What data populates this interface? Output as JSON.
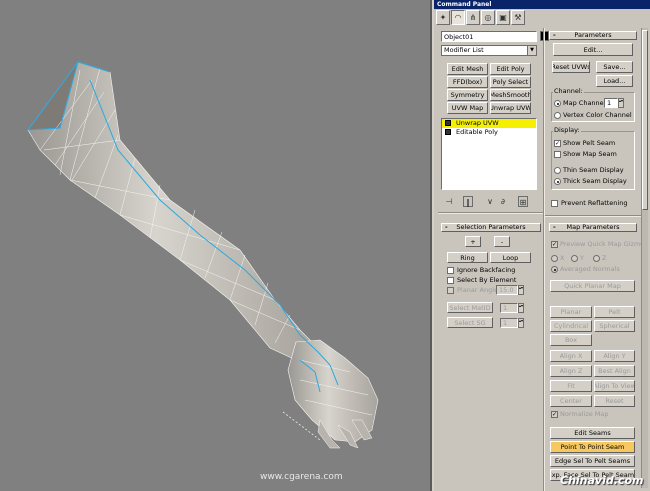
{
  "window": {
    "title": "Command Panel"
  },
  "tabs": [
    "create-tab",
    "modify-tab",
    "hierarchy-tab",
    "motion-tab",
    "display-tab",
    "utilities-tab"
  ],
  "object_name": "Object01",
  "object_color": "#000000",
  "modifier_list": "Modifier List",
  "modifier_buttons": [
    "Edit Mesh",
    "Edit Poly",
    "FFD(box)",
    "Poly Select",
    "Symmetry",
    "MeshSmooth",
    "UVW Map",
    "Unwrap UVW"
  ],
  "stack": [
    "Unwrap UVW",
    "Editable Poly"
  ],
  "parameters": {
    "header": "Parameters",
    "edit": "Edit...",
    "reset_uvws": "Reset UVWs",
    "save": "Save...",
    "load": "Load...",
    "channel_label": "Channel:",
    "map_channel": "Map Channel:",
    "map_channel_value": "1",
    "vertex_color_channel": "Vertex Color Channel",
    "display_label": "Display:",
    "show_pelt_seam": "Show Pelt Seam",
    "show_map_seam": "Show Map Seam",
    "thin_seam_display": "Thin Seam Display",
    "thick_seam_display": "Thick Seam Display",
    "prevent_reflattening": "Prevent Reflattening"
  },
  "selection_parameters": {
    "header": "Selection Parameters",
    "plus": "+",
    "minus": "-",
    "ring": "Ring",
    "loop": "Loop",
    "ignore_backfacing": "Ignore Backfacing",
    "select_by_element": "Select By Element",
    "planar_angle": "Planar Angle",
    "planar_angle_value": "15.0",
    "select_matid": "Select MatID",
    "select_sg": "Select SG",
    "matid_value": "1",
    "sg_value": "1"
  },
  "map_parameters": {
    "header": "Map Parameters",
    "preview_quick_map_gizmo": "Preview Quick Map Gizmo",
    "x": "X",
    "y": "Y",
    "z": "Z",
    "averaged_normals": "Averaged Normals",
    "quick_planar_map": "Quick Planar Map",
    "planar": "Planar",
    "pelt": "Pelt",
    "cylindrical": "Cylindrical",
    "spherical": "Spherical",
    "box": "Box",
    "align_x": "Align X",
    "align_y": "Align Y",
    "align_z": "Align Z",
    "best_align": "Best Align",
    "fit": "Fit",
    "align_to_view": "Align To View",
    "center": "Center",
    "reset": "Reset",
    "normalize_map": "Normalize Map",
    "edit_seams": "Edit Seams",
    "point_to_point_seam": "Point To Point Seam",
    "edge_sel_to_pelt_seams": "Edge Sel To Pelt Seams",
    "exp_face_sel_to_pelt_seams": "Exp. Face Sel To Pelt Seams"
  },
  "watermarks": {
    "site": "www.cgarena.com",
    "brand": "Chinavid.com"
  },
  "colors": {
    "viewport_bg": "#808080",
    "seam": "#2aa8e0",
    "highlight": "#f6c85f",
    "stack_selected": "#f5f000"
  }
}
